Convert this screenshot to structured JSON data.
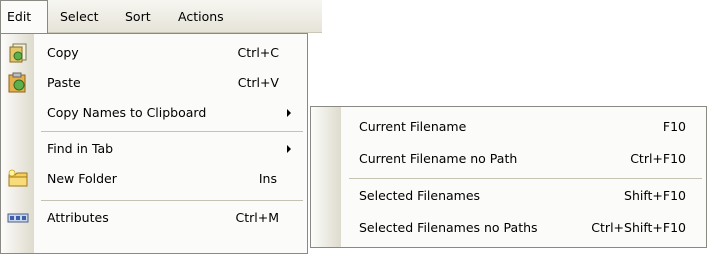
{
  "menubar": {
    "items": [
      {
        "label": "Edit"
      },
      {
        "label": "Select"
      },
      {
        "label": "Sort"
      },
      {
        "label": "Actions"
      }
    ]
  },
  "edit_menu": {
    "items": [
      {
        "label": "Copy",
        "shortcut": "Ctrl+C",
        "icon": "copy-icon"
      },
      {
        "label": "Paste",
        "shortcut": "Ctrl+V",
        "icon": "paste-icon"
      },
      {
        "label": "Copy Names to Clipboard",
        "shortcut": "",
        "icon": ""
      },
      {
        "label": "Find in Tab",
        "shortcut": "",
        "icon": ""
      },
      {
        "label": "New Folder",
        "shortcut": "Ins",
        "icon": "new-folder-icon"
      },
      {
        "label": "Attributes",
        "shortcut": "Ctrl+M",
        "icon": "attributes-icon"
      }
    ]
  },
  "clipboard_submenu": {
    "items": [
      {
        "label": "Current Filename",
        "shortcut": "F10"
      },
      {
        "label": "Current Filename no Path",
        "shortcut": "Ctrl+F10"
      },
      {
        "label": "Selected Filenames",
        "shortcut": "Shift+F10"
      },
      {
        "label": "Selected Filenames no Paths",
        "shortcut": "Ctrl+Shift+F10"
      }
    ]
  },
  "colors": {
    "menu_bg": "#fbfbf9",
    "gutter": "#dedbcd",
    "border": "#8a8a84",
    "separator": "#c6c3b4"
  }
}
